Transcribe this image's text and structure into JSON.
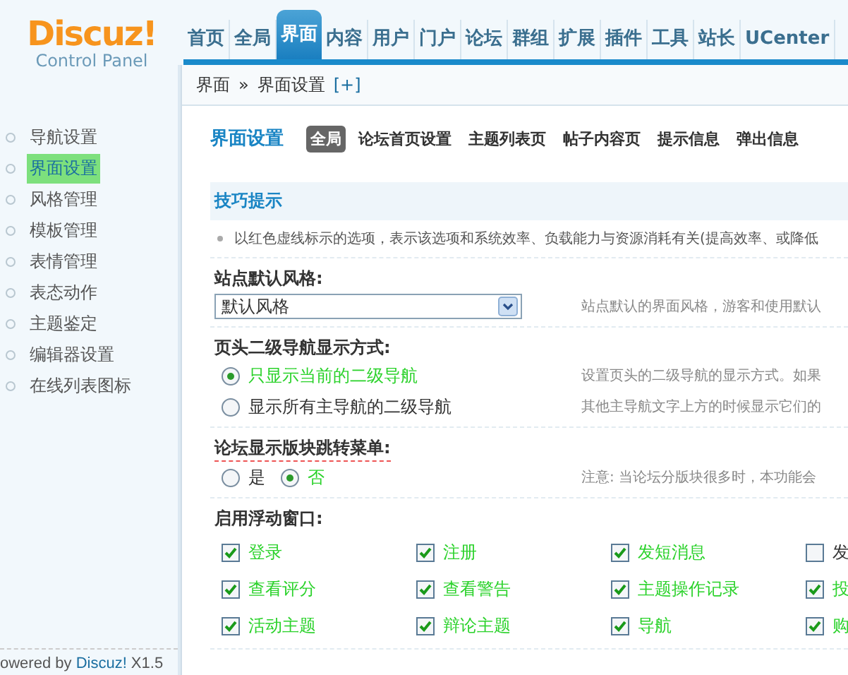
{
  "logo": {
    "name": "Discuz!",
    "subtitle": "Control Panel"
  },
  "nav": [
    {
      "label": "首页",
      "selected": false
    },
    {
      "label": "全局",
      "selected": false
    },
    {
      "label": "界面",
      "selected": true
    },
    {
      "label": "内容",
      "selected": false
    },
    {
      "label": "用户",
      "selected": false
    },
    {
      "label": "门户",
      "selected": false
    },
    {
      "label": "论坛",
      "selected": false
    },
    {
      "label": "群组",
      "selected": false
    },
    {
      "label": "扩展",
      "selected": false
    },
    {
      "label": "插件",
      "selected": false
    },
    {
      "label": "工具",
      "selected": false
    },
    {
      "label": "站长",
      "selected": false
    },
    {
      "label": "UCenter",
      "selected": false
    }
  ],
  "breadcrumb": {
    "parent": "界面",
    "separator": "»",
    "current": "界面设置",
    "add": "[+]"
  },
  "sidebar": {
    "items": [
      {
        "label": "导航设置",
        "selected": false
      },
      {
        "label": "界面设置",
        "selected": true
      },
      {
        "label": "风格管理",
        "selected": false
      },
      {
        "label": "模板管理",
        "selected": false
      },
      {
        "label": "表情管理",
        "selected": false
      },
      {
        "label": "表态动作",
        "selected": false
      },
      {
        "label": "主题鉴定",
        "selected": false
      },
      {
        "label": "编辑器设置",
        "selected": false
      },
      {
        "label": "在线列表图标",
        "selected": false
      }
    ],
    "footer": {
      "prefix": "owered by ",
      "brand": "Discuz!",
      "version": " X1.5"
    }
  },
  "page_title": "界面设置",
  "tabs": [
    {
      "label": "全局",
      "selected": true
    },
    {
      "label": "论坛首页设置",
      "selected": false
    },
    {
      "label": "主题列表页",
      "selected": false
    },
    {
      "label": "帖子内容页",
      "selected": false
    },
    {
      "label": "提示信息",
      "selected": false
    },
    {
      "label": "弹出信息",
      "selected": false
    }
  ],
  "tips": {
    "title": "技巧提示",
    "text": "以红色虚线标示的选项，表示该选项和系统效率、负载能力与资源消耗有关(提高效率、或降低"
  },
  "settings": [
    {
      "kind": "select",
      "label": "站点默认风格:",
      "value": "默认风格",
      "help": [
        "站点默认的界面风格，游客和使用默认"
      ]
    },
    {
      "kind": "radio",
      "label": "页头二级导航显示方式:",
      "options": [
        {
          "label": "只显示当前的二级导航",
          "selected": true
        },
        {
          "label": "显示所有主导航的二级导航",
          "selected": false
        }
      ],
      "help": [
        "设置页头的二级导航的显示方式。如果",
        "其他主导航文字上方的时候显示它们的"
      ]
    },
    {
      "kind": "radio-inline",
      "label": "论坛显示版块跳转菜单:",
      "options": [
        {
          "label": "是",
          "selected": false
        },
        {
          "label": "否",
          "selected": true
        }
      ],
      "help": [
        "注意: 当论坛分版块很多时，本功能会"
      ]
    },
    {
      "kind": "checks",
      "label": "启用浮动窗口:",
      "options": [
        {
          "label": "登录",
          "checked": true
        },
        {
          "label": "注册",
          "checked": true
        },
        {
          "label": "发短消息",
          "checked": true
        },
        {
          "label": "发",
          "checked": false
        },
        {
          "label": "查看评分",
          "checked": true
        },
        {
          "label": "查看警告",
          "checked": true
        },
        {
          "label": "主题操作记录",
          "checked": true
        },
        {
          "label": "投",
          "checked": true
        },
        {
          "label": "活动主题",
          "checked": true
        },
        {
          "label": "辩论主题",
          "checked": true
        },
        {
          "label": "导航",
          "checked": true
        },
        {
          "label": "购",
          "checked": true
        }
      ]
    }
  ]
}
